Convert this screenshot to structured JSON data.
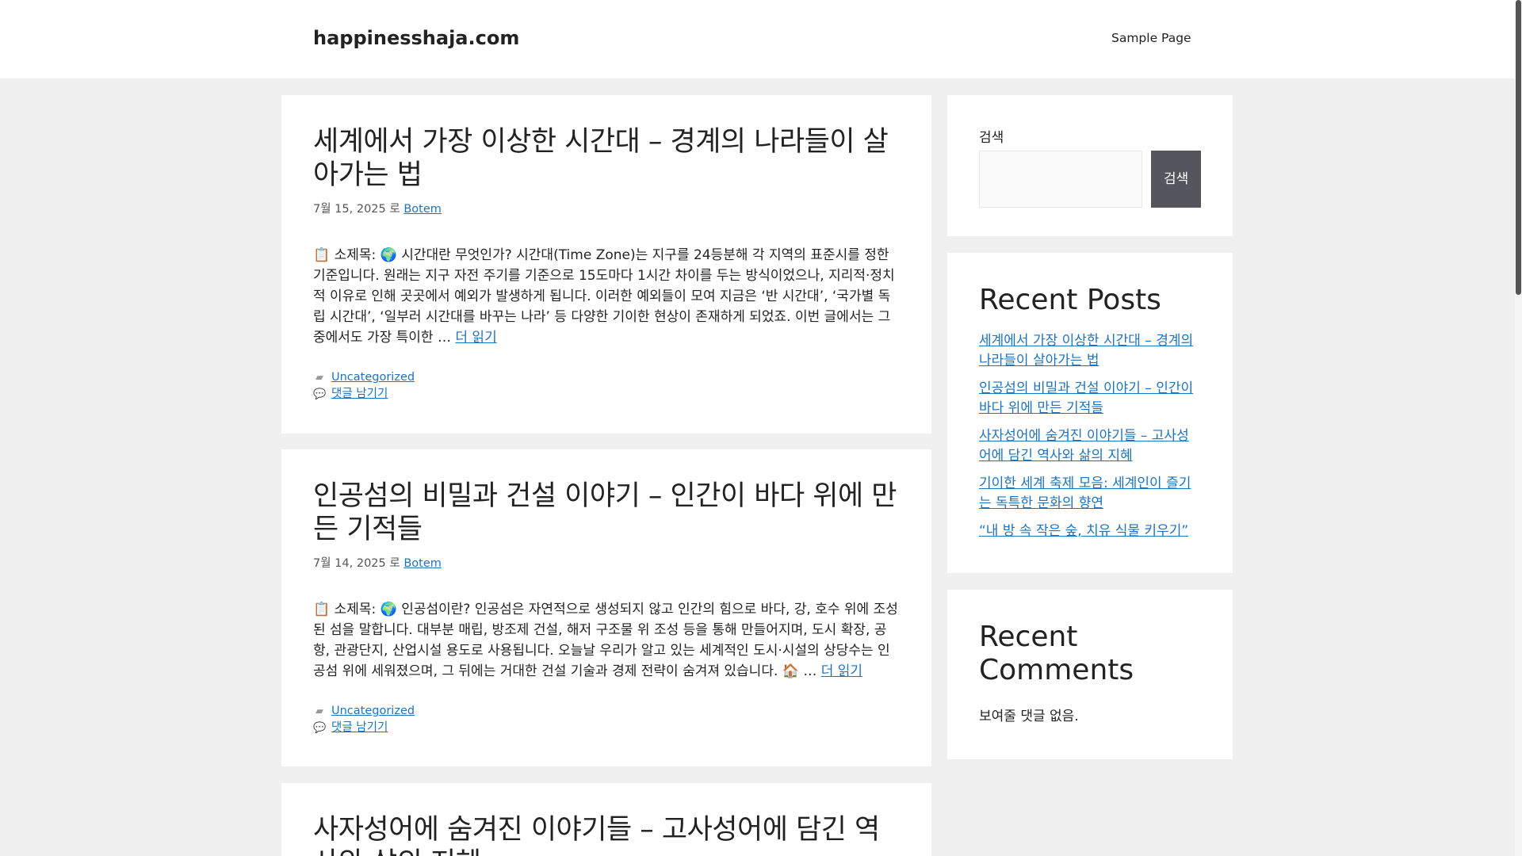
{
  "header": {
    "site_title": "happinesshaja.com",
    "nav": [
      "Sample Page"
    ]
  },
  "posts": [
    {
      "title": "세계에서 가장 이상한 시간대 – 경계의 나라들이 살아가는 법",
      "date": "7월 15, 2025",
      "by": "로",
      "author": "Botem",
      "excerpt": "📋 소제목: 🌍 시간대란 무엇인가? 시간대(Time Zone)는 지구를 24등분해 각 지역의 표준시를 정한 기준입니다. 원래는 지구 자전 주기를 기준으로 15도마다 1시간 차이를 두는 방식이었으나, 지리적·정치적 이유로 인해 곳곳에서 예외가 발생하게 됩니다. 이러한 예외들이 모여 지금은 ‘반 시간대’, ‘국가별 독립 시간대’, ‘일부러 시간대를 바꾸는 나라’ 등 다양한 기이한 현상이 존재하게 되었죠. 이번 글에서는 그 중에서도 가장 특이한 …",
      "read_more": "더 읽기",
      "category": "Uncategorized",
      "comments": "댓글 남기기"
    },
    {
      "title": "인공섬의 비밀과 건설 이야기 – 인간이 바다 위에 만든 기적들",
      "date": "7월 14, 2025",
      "by": "로",
      "author": "Botem",
      "excerpt": "📋 소제목: 🌍 인공섬이란? 인공섬은 자연적으로 생성되지 않고 인간의 힘으로 바다, 강, 호수 위에 조성된 섬을 말합니다. 대부분 매립, 방조제 건설, 해저 구조물 위 조성 등을 통해 만들어지며, 도시 확장, 공항, 관광단지, 산업시설 용도로 사용됩니다. 오늘날 우리가 알고 있는 세계적인 도시·시설의 상당수는 인공섬 위에 세워졌으며, 그 뒤에는 거대한 건설 기술과 경제 전략이 숨겨져 있습니다. 🏠 …",
      "read_more": "더 읽기",
      "category": "Uncategorized",
      "comments": "댓글 남기기"
    },
    {
      "title": "사자성어에 숨겨진 이야기들 – 고사성어에 담긴 역사와 삶의 지혜"
    }
  ],
  "sidebar": {
    "search_label": "검색",
    "search_button": "검색",
    "recent_posts_title": "Recent Posts",
    "recent_posts": [
      "세계에서 가장 이상한 시간대 – 경계의 나라들이 살아가는 법",
      "인공섬의 비밀과 건설 이야기 – 인간이 바다 위에 만든 기적들",
      "사자성어에 숨겨진 이야기들 – 고사성어에 담긴 역사와 삶의 지혜",
      "기이한 세계 축제 모음: 세계인이 즐기는 독특한 문화의 향연",
      "“내 방 속 작은 숲, 치유 식물 키우기”"
    ],
    "recent_comments_title": "Recent Comments",
    "no_comments": "보여줄 댓글 없음."
  }
}
